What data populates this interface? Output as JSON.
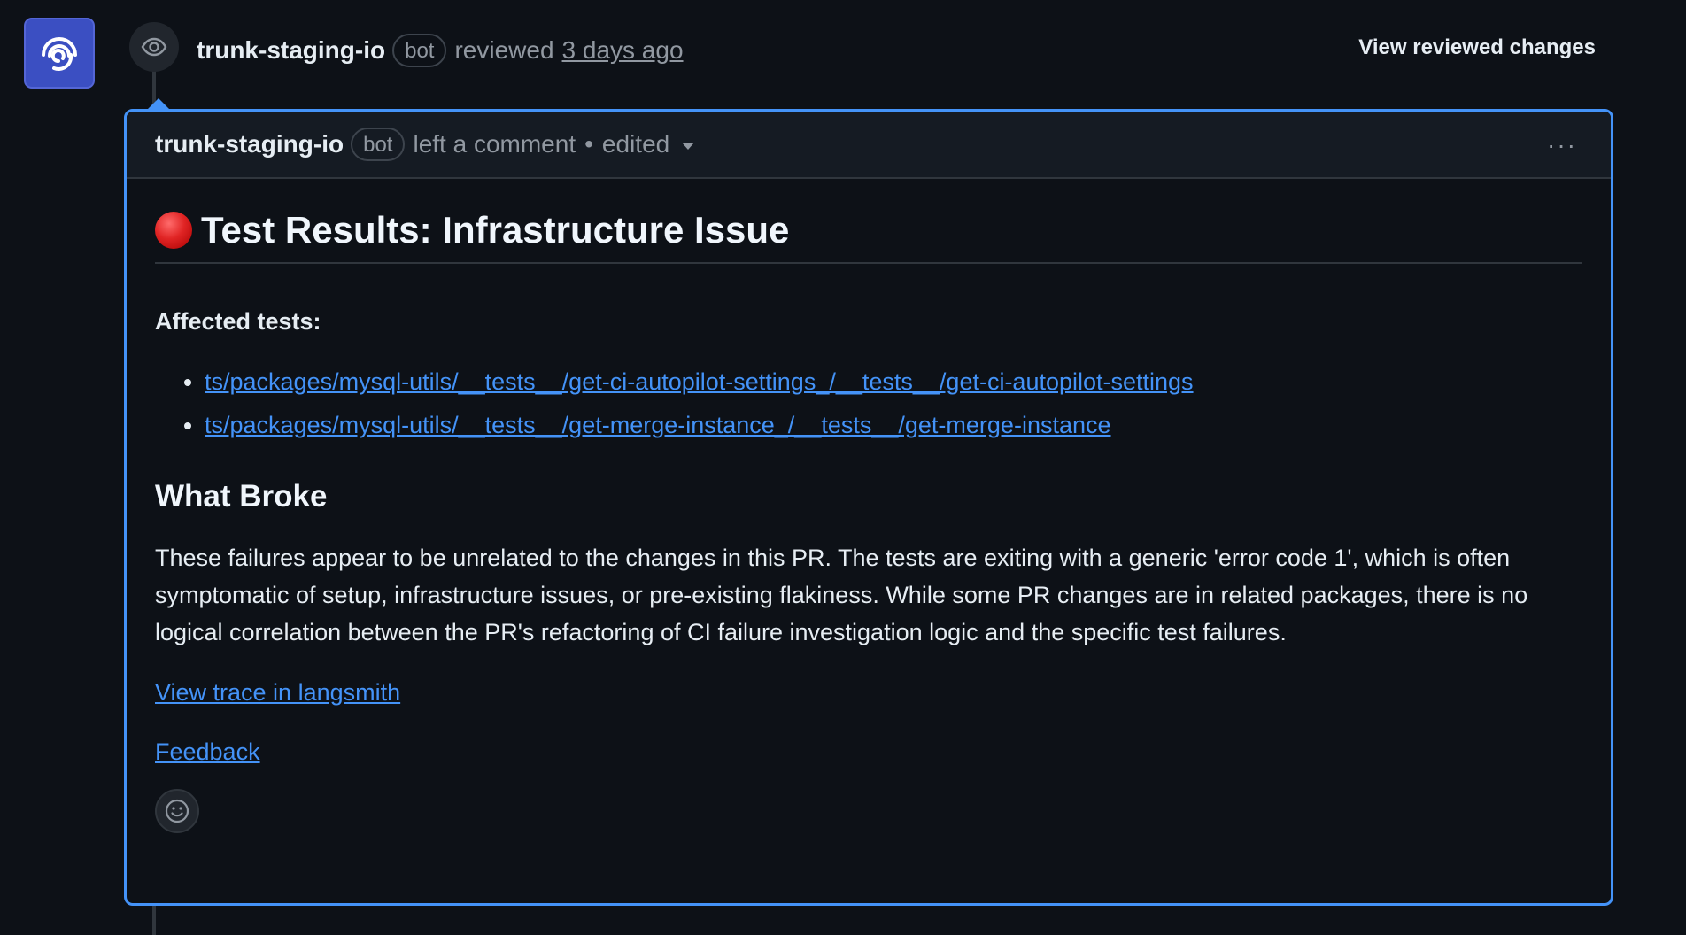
{
  "timeline": {
    "author": "trunk-staging-io",
    "bot_badge": "bot",
    "action": "reviewed",
    "time": "3 days ago",
    "view_changes_label": "View reviewed changes"
  },
  "comment": {
    "author": "trunk-staging-io",
    "bot_badge": "bot",
    "action": "left a comment",
    "separator": "•",
    "edited_label": "edited",
    "menu_label": "···",
    "heading": "Test Results: Infrastructure Issue",
    "affected_label": "Affected tests:",
    "tests": [
      "ts/packages/mysql-utils/__tests__/get-ci-autopilot-settings_/__tests__/get-ci-autopilot-settings",
      "ts/packages/mysql-utils/__tests__/get-merge-instance_/__tests__/get-merge-instance"
    ],
    "section_heading": "What Broke",
    "body": "These failures appear to be unrelated to the changes in this PR. The tests are exiting with a generic 'error code 1', which is often symptomatic of setup, infrastructure issues, or pre-existing flakiness. While some PR changes are in related packages, there is no logical correlation between the PR's refactoring of CI failure investigation logic and the specific test failures.",
    "trace_link": "View trace in langsmith",
    "feedback_link": "Feedback"
  },
  "icons": {
    "avatar": "trunk-logo-icon",
    "eye": "eye-icon",
    "status": "red-circle-icon",
    "reaction": "smiley-icon"
  },
  "colors": {
    "background": "#0d1117",
    "accent": "#4493f8",
    "avatar": "#3b4fc2",
    "status_red": "#e02424"
  }
}
